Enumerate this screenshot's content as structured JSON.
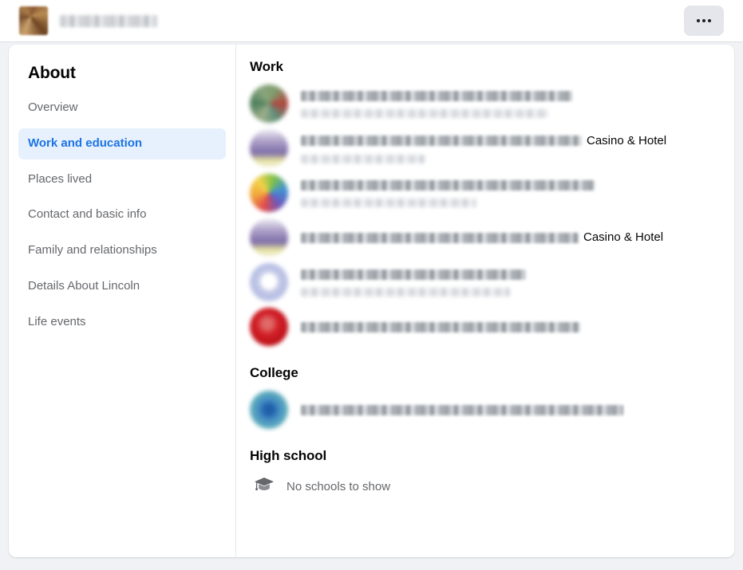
{
  "header": {
    "profile_name": "[redacted name]",
    "avatar": "profile-avatar",
    "more_button_label": "•••"
  },
  "sidebar": {
    "title": "About",
    "items": [
      {
        "label": "Overview",
        "active": false
      },
      {
        "label": "Work and education",
        "active": true
      },
      {
        "label": "Places lived",
        "active": false
      },
      {
        "label": "Contact and basic info",
        "active": false
      },
      {
        "label": "Family and relationships",
        "active": false
      },
      {
        "label": "Details About Lincoln",
        "active": false
      },
      {
        "label": "Life events",
        "active": false
      }
    ]
  },
  "main": {
    "sections": [
      {
        "title": "Work",
        "entries": [
          {
            "thumb": "t1",
            "title_redacted_width": 340,
            "subtitle_redacted_width": 310,
            "tail_text": ""
          },
          {
            "thumb": "t2",
            "title_redacted_width": 352,
            "subtitle_redacted_width": 155,
            "tail_text": "Casino & Hotel"
          },
          {
            "thumb": "t3",
            "title_redacted_width": 368,
            "subtitle_redacted_width": 220,
            "tail_text": ""
          },
          {
            "thumb": "t4",
            "title_redacted_width": 348,
            "subtitle_redacted_width": 0,
            "tail_text": "Casino & Hotel"
          },
          {
            "thumb": "t5",
            "title_redacted_width": 282,
            "subtitle_redacted_width": 262,
            "tail_text": ""
          },
          {
            "thumb": "t6",
            "title_redacted_width": 350,
            "subtitle_redacted_width": 0,
            "tail_text": ""
          }
        ]
      },
      {
        "title": "College",
        "entries": [
          {
            "thumb": "t7",
            "title_redacted_width": 404,
            "subtitle_redacted_width": 0,
            "tail_text": ""
          }
        ]
      },
      {
        "title": "High school",
        "empty_text": "No schools to show",
        "empty_icon": "graduation-cap-icon",
        "entries": []
      }
    ]
  },
  "colors": {
    "page_background": "#f0f2f5",
    "card_background": "#ffffff",
    "accent_blue": "#1b74e4",
    "active_item_background": "#e7f0fd",
    "primary_text": "#050505",
    "secondary_text": "#65676b",
    "button_background": "#e4e6eb"
  }
}
